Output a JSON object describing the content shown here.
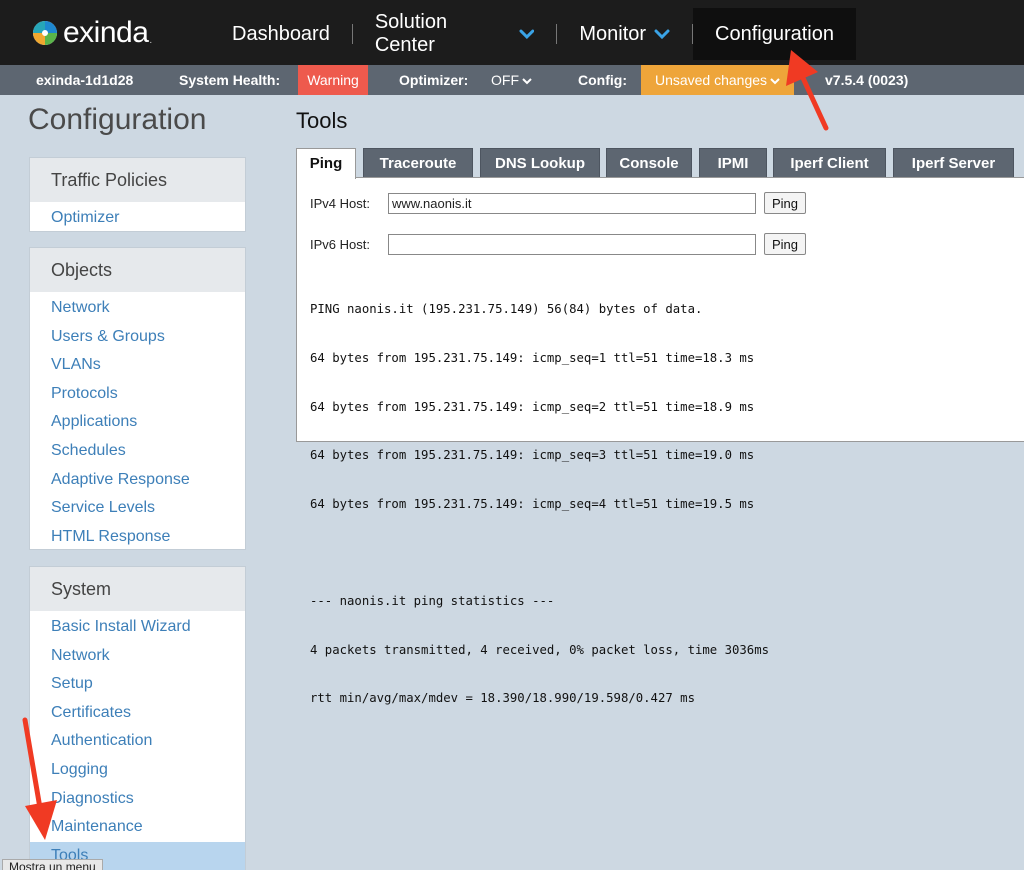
{
  "brand": {
    "name": "exinda",
    "tm": "."
  },
  "nav": {
    "items": [
      {
        "label": "Dashboard",
        "has_menu": false
      },
      {
        "label": "Solution Center",
        "has_menu": true
      },
      {
        "label": "Monitor",
        "has_menu": true
      },
      {
        "label": "Configuration",
        "has_menu": false
      }
    ],
    "active": "Configuration"
  },
  "status": {
    "hostname": "exinda-1d1d28",
    "health_label": "System Health:",
    "health_value": "Warning",
    "optimizer_label": "Optimizer:",
    "optimizer_value": "OFF",
    "config_label": "Config:",
    "config_value": "Unsaved changes",
    "version": "v7.5.4 (0023)"
  },
  "page_title": "Configuration",
  "sidebar": {
    "traffic": {
      "heading": "Traffic Policies",
      "items": [
        "Optimizer"
      ]
    },
    "objects": {
      "heading": "Objects",
      "items": [
        "Network",
        "Users & Groups",
        "VLANs",
        "Protocols",
        "Applications",
        "Schedules",
        "Adaptive Response",
        "Service Levels",
        "HTML Response"
      ]
    },
    "system": {
      "heading": "System",
      "items": [
        "Basic Install Wizard",
        "Network",
        "Setup",
        "Certificates",
        "Authentication",
        "Logging",
        "Diagnostics",
        "Maintenance",
        "Tools"
      ],
      "selected": "Tools"
    }
  },
  "tools": {
    "title": "Tools",
    "tabs": [
      "Ping",
      "Traceroute",
      "DNS Lookup",
      "Console",
      "IPMI",
      "Iperf Client",
      "Iperf Server"
    ],
    "active_tab": "Ping",
    "ipv4_label": "IPv4 Host:",
    "ipv4_value": "www.naonis.it",
    "ipv6_label": "IPv6 Host:",
    "ipv6_value": "",
    "ping_button": "Ping",
    "output": [
      "PING naonis.it (195.231.75.149) 56(84) bytes of data.",
      "64 bytes from 195.231.75.149: icmp_seq=1 ttl=51 time=18.3 ms",
      "64 bytes from 195.231.75.149: icmp_seq=2 ttl=51 time=18.9 ms",
      "64 bytes from 195.231.75.149: icmp_seq=3 ttl=51 time=19.0 ms",
      "64 bytes from 195.231.75.149: icmp_seq=4 ttl=51 time=19.5 ms",
      "",
      "--- naonis.it ping statistics ---",
      "4 packets transmitted, 4 received, 0% packet loss, time 3036ms",
      "rtt min/avg/max/mdev = 18.390/18.990/19.598/0.427 ms"
    ]
  },
  "tooltip": "Mostra un menu",
  "colors": {
    "warning": "#ee5a4d",
    "unsaved": "#eea53a",
    "annotation_arrow": "#f03a23",
    "link": "#3d7fb8"
  }
}
